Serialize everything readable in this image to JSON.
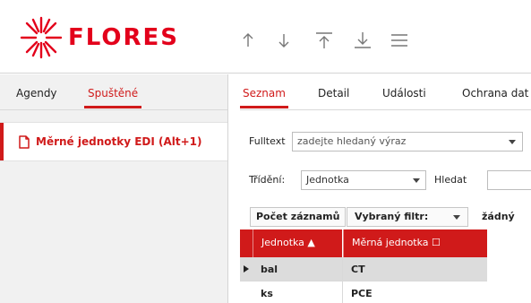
{
  "app": {
    "brand": "FLORES",
    "colors": {
      "accent": "#d01a1a",
      "logo": "#e3001b",
      "panel_bg": "#f1f1f1",
      "selected_row": "#dcdcdc"
    }
  },
  "toolbar": {
    "icons": [
      "arrow-up-icon",
      "arrow-down-icon",
      "arrow-to-top-icon",
      "arrow-to-bottom-icon",
      "menu-icon"
    ]
  },
  "left_panel": {
    "tabs": [
      {
        "label": "Agendy",
        "active": false
      },
      {
        "label": "Spuštěné",
        "active": true
      }
    ],
    "items": [
      {
        "label": "Měrné jednotky EDI (Alt+1)",
        "icon": "document-icon"
      }
    ]
  },
  "right_panel": {
    "tabs": [
      {
        "label": "Seznam",
        "active": true
      },
      {
        "label": "Detail",
        "active": false
      },
      {
        "label": "Události",
        "active": false
      },
      {
        "label": "Ochrana dat",
        "active": false
      }
    ],
    "fulltext": {
      "label": "Fulltext",
      "placeholder": "zadejte hledaný výraz"
    },
    "sort": {
      "label": "Třídění:",
      "value": "Jednotka"
    },
    "search": {
      "label": "Hledat",
      "value": ""
    },
    "record_count_button": "Počet záznamů",
    "filter": {
      "label": "Vybraný filtr:",
      "value": "žádný"
    },
    "grid": {
      "columns": [
        "Jednotka ▲",
        "Měrná jednotka ☐"
      ],
      "rows": [
        {
          "cells": [
            "bal",
            "CT"
          ],
          "selected": true
        },
        {
          "cells": [
            "ks",
            "PCE"
          ],
          "selected": false
        }
      ]
    }
  }
}
